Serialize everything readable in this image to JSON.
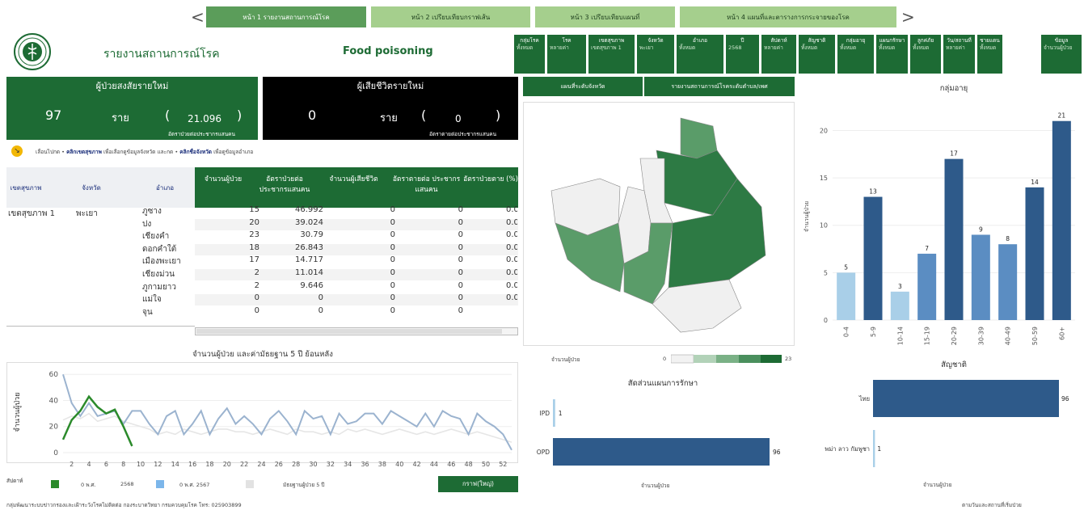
{
  "nav": {
    "prev": "<",
    "next": ">",
    "tabs": [
      "หน้า 1 รายงานสถานการณ์โรค",
      "หน้า 2 เปรียบเทียบกราฟเส้น",
      "หน้า 3 เปรียบเทียบแผนที่",
      "หน้า 4 แผนที่และตารางการกระจายของโรค"
    ]
  },
  "header": {
    "title": "รายงานสถานการณ์โรค",
    "disease": "Food poisoning"
  },
  "filters": [
    {
      "label": "กลุ่มโรค",
      "value": "ทั้งหมด"
    },
    {
      "label": "โรค",
      "value": "หลายค่า"
    },
    {
      "label": "เขตสุขภาพ",
      "value": "เขตสุขภาพ 1"
    },
    {
      "label": "จังหวัด",
      "value": "พะเยา"
    },
    {
      "label": "อำเภอ",
      "value": "ทั้งหมด"
    },
    {
      "label": "ปี",
      "value": "2568"
    },
    {
      "label": "สัปดาห์",
      "value": "หลายค่า"
    },
    {
      "label": "สัญชาติ",
      "value": "ทั้งหมด"
    },
    {
      "label": "กลุ่มอายุ",
      "value": "ทั้งหมด"
    },
    {
      "label": "แผนกรักษา",
      "value": "ทั้งหมด"
    },
    {
      "label": "ลูกค่ภัย",
      "value": "ทั้งหมด"
    },
    {
      "label": "วัน/สถานที่",
      "value": "หลายค่า"
    },
    {
      "label": "ชายแดน",
      "value": "ทั้งหมด"
    },
    {
      "label": "ข้อมูล",
      "value": "จำนวนผู้ป่วย"
    }
  ],
  "kpi_cases": {
    "title": "ผู้ป่วยสงสัยรายใหม่",
    "value": "97",
    "unit": "ราย",
    "open": "(",
    "rate": "21.096",
    "close": ")",
    "sub": "อัตราป่วยต่อประชากรแสนคน"
  },
  "kpi_deaths": {
    "title": "ผู้เสียชีวิตรายใหม่",
    "value": "0",
    "unit": "ราย",
    "open": "(",
    "rate": "0",
    "close": ")",
    "sub": "อัตราตายต่อประชากรแสนคน"
  },
  "hint": {
    "a": "เลื่อนไปกด",
    "b": "คลิกเขตสุขภาพ",
    "c": "เพื่อเลือกดูข้อมูลจังหวัด และกด",
    "d": "คลิกชื่อจังหวัด",
    "e": "เพื่อดูข้อมูลอำเภอ"
  },
  "table": {
    "left_headers": [
      "เขตสุขภาพ",
      "จังหวัด",
      "อำเภอ"
    ],
    "headers": [
      "จำนวนผู้ป่วย",
      "อัตราป่วยต่อ ประชากรแสนคน",
      "จำนวนผู้เสียชีวิต",
      "อัตราตายต่อ ประชากรแสนคน",
      "อัตราป่วยตาย (%)"
    ],
    "region": "เขตสุขภาพ 1",
    "province": "พะเยา",
    "rows": [
      {
        "district": "ภูซาง",
        "cases": "15",
        "rate": "46.992",
        "deaths": "0",
        "drate": "0",
        "cfr": "0.0"
      },
      {
        "district": "ปง",
        "cases": "20",
        "rate": "39.024",
        "deaths": "0",
        "drate": "0",
        "cfr": "0.0"
      },
      {
        "district": "เชียงคำ",
        "cases": "23",
        "rate": "30.79",
        "deaths": "0",
        "drate": "0",
        "cfr": "0.0"
      },
      {
        "district": "ดอกคำใต้",
        "cases": "18",
        "rate": "26.843",
        "deaths": "0",
        "drate": "0",
        "cfr": "0.0"
      },
      {
        "district": "เมืองพะเยา",
        "cases": "17",
        "rate": "14.717",
        "deaths": "0",
        "drate": "0",
        "cfr": "0.0"
      },
      {
        "district": "เชียงม่วน",
        "cases": "2",
        "rate": "11.014",
        "deaths": "0",
        "drate": "0",
        "cfr": "0.0"
      },
      {
        "district": "ภูกามยาว",
        "cases": "2",
        "rate": "9.646",
        "deaths": "0",
        "drate": "0",
        "cfr": "0.0"
      },
      {
        "district": "แม่ใจ",
        "cases": "0",
        "rate": "0",
        "deaths": "0",
        "drate": "0",
        "cfr": "0.0"
      },
      {
        "district": "จุน",
        "cases": "0",
        "rate": "0",
        "deaths": "0",
        "drate": "0",
        "cfr": ""
      }
    ]
  },
  "map": {
    "btn1": "แผนที่ระดับจังหวัด",
    "btn2": "รายงานสถานการณ์โรคระดับตำบล/เพศ",
    "legend_label": "จำนวนผู้ป่วย",
    "legend_min": "0",
    "legend_max": "23"
  },
  "footer": {
    "left": "กลุ่มพัฒนาระบบข่าวกรองและเฝ้าระวังโรคไม่ติดต่อ กองระบาดวิทยา กรมควบคุมโรค โทร: 025903899",
    "right": "ตามวันและสถานที่เริ่มป่วย"
  },
  "line_legend": {
    "week_label": "สัปดาห์",
    "s1": "0 พ.ศ.",
    "s1v": "2568",
    "s2": "0 พ.ศ. 2567",
    "s3": "มัธยฐานผู้ป่วย 5 ปี",
    "btn": "กราฟ(ใหญ่)"
  },
  "colors": {
    "dark_green": "#1d6b34",
    "tab": "#a5cf8d",
    "tab_active": "#5b9d5a",
    "bar_dark": "#2e5a8a",
    "bar_mid": "#5b8dc2",
    "bar_light": "#a9cfe8"
  },
  "chart_data": [
    {
      "type": "bar",
      "title": "กลุ่มอายุ",
      "ylabel": "จำนวนผู้ป่วย",
      "categories": [
        "0-4",
        "5-9",
        "10-14",
        "15-19",
        "20-29",
        "30-39",
        "40-49",
        "50-59",
        "60+"
      ],
      "values": [
        5,
        13,
        3,
        7,
        17,
        9,
        8,
        14,
        21
      ],
      "ylim": [
        0,
        22
      ],
      "yticks": [
        0,
        5,
        10,
        15,
        20
      ]
    },
    {
      "type": "line",
      "title": "จำนวนผู้ป่วย และค่ามัธยฐาน 5 ปี ย้อนหลัง",
      "ylabel": "จำนวนผู้ป่วย",
      "xticks": [
        2,
        4,
        6,
        8,
        10,
        12,
        14,
        16,
        18,
        20,
        22,
        24,
        26,
        28,
        30,
        32,
        34,
        36,
        38,
        40,
        42,
        44,
        46,
        48,
        50,
        52
      ],
      "yticks": [
        0,
        20,
        40,
        60
      ],
      "ylim": [
        0,
        62
      ],
      "series": [
        {
          "name": "2568",
          "values": [
            10,
            25,
            32,
            43,
            35,
            30,
            33,
            20,
            5
          ]
        },
        {
          "name": "0 พ.ศ. 2567",
          "values": [
            60,
            38,
            28,
            38,
            28,
            30,
            32,
            22,
            32,
            32,
            22,
            14,
            28,
            32,
            14,
            22,
            32,
            14,
            26,
            34,
            22,
            28,
            22,
            14,
            26,
            32,
            24,
            14,
            32,
            26,
            28,
            14,
            30,
            22,
            24,
            30,
            30,
            22,
            32,
            28,
            24,
            20,
            30,
            20,
            32,
            28,
            26,
            14,
            30,
            24,
            20,
            14,
            2
          ]
        },
        {
          "name": "มัธยฐานผู้ป่วย 5 ปี",
          "values": [
            25,
            28,
            26,
            30,
            24,
            26,
            28,
            24,
            22,
            20,
            18,
            14,
            16,
            14,
            18,
            16,
            14,
            16,
            18,
            18,
            16,
            16,
            14,
            16,
            18,
            16,
            14,
            18,
            16,
            16,
            14,
            16,
            14,
            18,
            16,
            18,
            16,
            14,
            16,
            18,
            16,
            14,
            16,
            14,
            16,
            18,
            16,
            14,
            16,
            14,
            12,
            10,
            8
          ]
        }
      ]
    },
    {
      "type": "bar",
      "title": "สัดส่วนแผนการรักษา",
      "xlabel": "จำนวนผู้ป่วย",
      "categories": [
        "IPD",
        "OPD"
      ],
      "values": [
        1,
        96
      ]
    },
    {
      "type": "bar",
      "title": "สัญชาติ",
      "xlabel": "จำนวนผู้ป่วย",
      "categories": [
        "ไทย",
        "พม่า ลาว กัมพูชา"
      ],
      "values": [
        96,
        1
      ]
    }
  ]
}
